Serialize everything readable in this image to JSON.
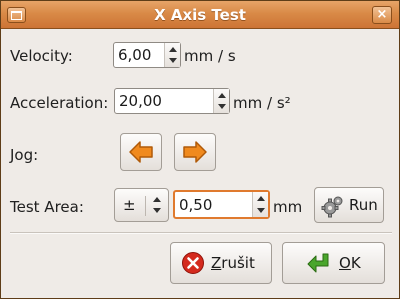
{
  "window": {
    "title": "X Axis Test",
    "close_glyph": "×"
  },
  "velocity": {
    "label": "Velocity:",
    "value": "6,00",
    "unit": "mm / s"
  },
  "acceleration": {
    "label": "Acceleration:",
    "value": "20,00",
    "unit": "mm / s²"
  },
  "jog": {
    "label": "Jog:",
    "left_icon": "arrow-left-icon",
    "right_icon": "arrow-right-icon"
  },
  "test_area": {
    "label": "Test Area:",
    "mode": "±",
    "value": "0,50",
    "unit": "mm",
    "run_label": "Run"
  },
  "buttons": {
    "cancel_mnemonic": "Z",
    "cancel_rest": "rušit",
    "ok_mnemonic": "O",
    "ok_rest": "K"
  },
  "colors": {
    "titlebar": "#d98a47",
    "accent_focus": "#e07a2e",
    "arrow_orange": "#f08a1e",
    "ok_green": "#4aa62c",
    "cancel_red": "#d42a1e"
  }
}
